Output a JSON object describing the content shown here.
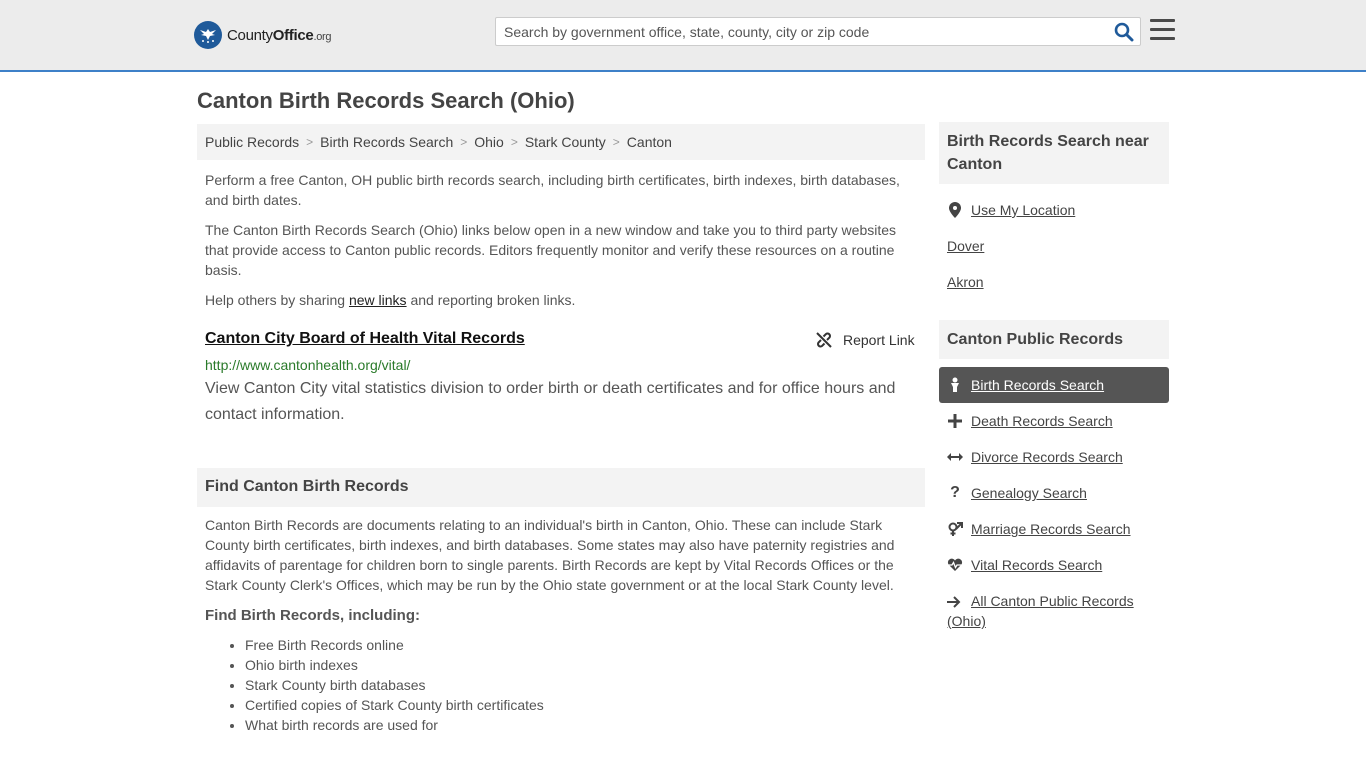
{
  "header": {
    "logo": {
      "brand_part1": "County",
      "brand_part2": "Office",
      "brand_tld": ".org"
    },
    "search_placeholder": "Search by government office, state, county, city or zip code",
    "search_icon": "magnifier-icon",
    "menu_icon": "hamburger-icon"
  },
  "page_title": "Canton Birth Records Search (Ohio)",
  "breadcrumb": [
    "Public Records",
    "Birth Records Search",
    "Ohio",
    "Stark County",
    "Canton"
  ],
  "intro": {
    "p1": "Perform a free Canton, OH public birth records search, including birth certificates, birth indexes, birth databases, and birth dates.",
    "p2": "The Canton Birth Records Search (Ohio) links below open in a new window and take you to third party websites that provide access to Canton public records. Editors frequently monitor and verify these resources on a routine basis.",
    "p3_before": "Help others by sharing ",
    "p3_link": "new links",
    "p3_after": " and reporting broken links."
  },
  "result": {
    "title": "Canton City Board of Health Vital Records",
    "report_label": "Report Link",
    "url": "http://www.cantonhealth.org/vital/",
    "description": "View Canton City vital statistics division to order birth or death certificates and for office hours and contact information."
  },
  "find_section": {
    "heading": "Find Canton Birth Records",
    "body": "Canton Birth Records are documents relating to an individual's birth in Canton, Ohio. These can include Stark County birth certificates, birth indexes, and birth databases. Some states may also have paternity registries and affidavits of parentage for children born to single parents. Birth Records are kept by Vital Records Offices or the Stark County Clerk's Offices, which may be run by the Ohio state government or at the local Stark County level.",
    "subheading": "Find Birth Records, including:",
    "items": [
      "Free Birth Records online",
      "Ohio birth indexes",
      "Stark County birth databases",
      "Certified copies of Stark County birth certificates",
      "What birth records are used for"
    ]
  },
  "sidebar": {
    "near_heading": "Birth Records Search near Canton",
    "near_items": [
      {
        "label": "Use My Location",
        "icon": "map-pin-icon"
      },
      {
        "label": "Dover"
      },
      {
        "label": "Akron"
      }
    ],
    "records_heading": "Canton Public Records",
    "records_items": [
      {
        "label": "Birth Records Search",
        "icon": "baby-icon",
        "active": true
      },
      {
        "label": "Death Records Search",
        "icon": "cross-icon"
      },
      {
        "label": "Divorce Records Search",
        "icon": "arrows-horizontal-icon"
      },
      {
        "label": "Genealogy Search",
        "icon": "question-icon"
      },
      {
        "label": "Marriage Records Search",
        "icon": "gender-icon"
      },
      {
        "label": "Vital Records Search",
        "icon": "heartbeat-icon"
      },
      {
        "label": "All Canton Public Records (Ohio)",
        "icon": "arrow-right-icon"
      }
    ]
  },
  "colors": {
    "accent": "#3e80c8",
    "header_bg": "#ececec",
    "active_bg": "#555555",
    "url_green": "#2a7a2a"
  }
}
